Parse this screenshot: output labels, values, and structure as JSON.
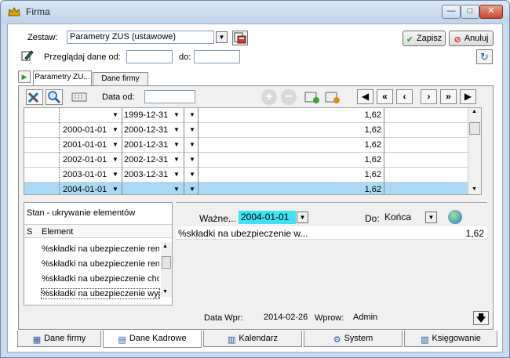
{
  "window": {
    "title": "Firma"
  },
  "header": {
    "zestaw_label": "Zestaw:",
    "zestaw_value": "Parametry ZUS (ustawowe)",
    "zapisz_label": "Zapisz",
    "anuluj_label": "Anuluj",
    "przegladaj_label": "Przeglądaj dane od:",
    "od_value": "",
    "do_label": "do:",
    "do_value": ""
  },
  "tabs": [
    {
      "label": "Parametry ZU..."
    },
    {
      "label": "Dane firmy"
    }
  ],
  "toolbar": {
    "data_od_label": "Data od:",
    "data_od_value": ""
  },
  "grid": {
    "rows": [
      {
        "from": "",
        "to": "1999-12-31",
        "value": "1,62",
        "selected": false
      },
      {
        "from": "2000-01-01",
        "to": "2000-12-31",
        "value": "1,62",
        "selected": false
      },
      {
        "from": "2001-01-01",
        "to": "2001-12-31",
        "value": "1,62",
        "selected": false
      },
      {
        "from": "2002-01-01",
        "to": "2002-12-31",
        "value": "1,62",
        "selected": false
      },
      {
        "from": "2003-01-01",
        "to": "2003-12-31",
        "value": "1,62",
        "selected": false
      },
      {
        "from": "2004-01-01",
        "to": "",
        "value": "1,62",
        "selected": true
      }
    ]
  },
  "elements_panel": {
    "title": "Stan - ukrywanie elementów",
    "col_s": "S",
    "col_element": "Element",
    "items": [
      "%składki na ubezpieczenie rent",
      "%składki na ubezpieczenie rent",
      "%składki na ubezpieczenie chor",
      "%składki na ubezpieczenie wyp"
    ]
  },
  "detail": {
    "wazne_label": "Ważne...",
    "wazne_value": "2004-01-01",
    "do_label": "Do:",
    "do_value": "Końca",
    "row_name": "%składki na ubezpieczenie w...",
    "row_value": "1,62"
  },
  "status": {
    "data_wpr_label": "Data Wpr:",
    "data_wpr_value": "2014-02-26",
    "wprow_label": "Wprow:",
    "wprow_value": "Admin"
  },
  "bottom_tabs": [
    {
      "label": "Dane firmy",
      "icon": "building-icon"
    },
    {
      "label": "Dane Kadrowe",
      "icon": "document-icon"
    },
    {
      "label": "Kalendarz",
      "icon": "calendar-icon"
    },
    {
      "label": "System",
      "icon": "system-icon"
    },
    {
      "label": "Księgowanie",
      "icon": "ledger-icon"
    }
  ],
  "colors": {
    "selection": "#a9d9f5",
    "highlight_field": "#3fe2f2",
    "titlebar": "#c9dbee"
  }
}
